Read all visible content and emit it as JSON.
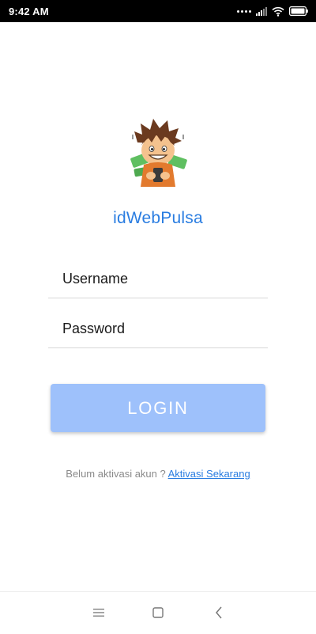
{
  "status_bar": {
    "time": "9:42 AM"
  },
  "app": {
    "title": "idWebPulsa"
  },
  "form": {
    "username_placeholder": "Username",
    "password_placeholder": "Password",
    "login_label": "LOGIN"
  },
  "activation": {
    "prompt": "Belum aktivasi akun ? ",
    "link_label": "Aktivasi Sekarang"
  },
  "colors": {
    "accent": "#2a7de1",
    "button_disabled": "#9ec1fb"
  },
  "icons": {
    "status": [
      "signal-dots-icon",
      "cellular-signal-icon",
      "wifi-icon",
      "battery-icon"
    ],
    "nav": [
      "menu-icon",
      "home-icon",
      "back-icon"
    ]
  }
}
